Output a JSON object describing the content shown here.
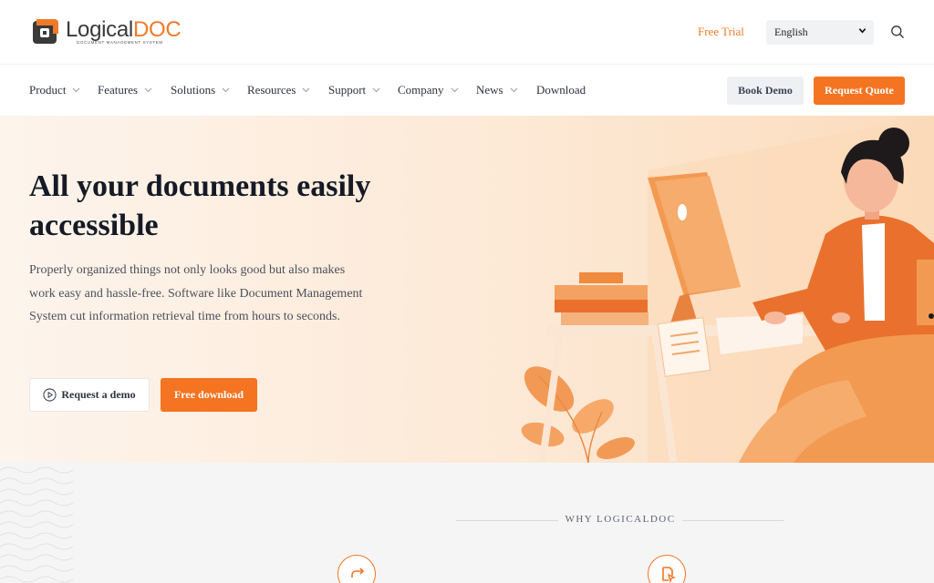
{
  "brand": {
    "name_part1": "Logical",
    "name_part2": "DOC",
    "tagline": "DOCUMENT MANAGEMENT SYSTEM",
    "logo_icon": "logicaldoc-logo-icon"
  },
  "header": {
    "free_trial": "Free Trial",
    "language": {
      "selected": "English"
    },
    "search_icon": "search-icon"
  },
  "nav": {
    "items": [
      {
        "label": "Product",
        "dropdown": true
      },
      {
        "label": "Features",
        "dropdown": true
      },
      {
        "label": "Solutions",
        "dropdown": true
      },
      {
        "label": "Resources",
        "dropdown": true
      },
      {
        "label": "Support",
        "dropdown": true
      },
      {
        "label": "Company",
        "dropdown": true
      },
      {
        "label": "News",
        "dropdown": true
      },
      {
        "label": "Download",
        "dropdown": false
      }
    ],
    "book_demo": "Book Demo",
    "request_quote": "Request Quote"
  },
  "hero": {
    "title": "All your documents easily accessible",
    "description": "Properly organized things not only looks good but also makes work easy and hassle-free. Software like Document Management System cut information retrieval time from hours to seconds.",
    "demo_button": "Request a demo",
    "download_button": "Free download"
  },
  "why": {
    "label": "WHY LOGICALDOC"
  },
  "colors": {
    "accent": "#f47421",
    "brand_orange": "#f07a28",
    "hero_bg": "#fde9d6",
    "text_dark": "#151a26"
  }
}
